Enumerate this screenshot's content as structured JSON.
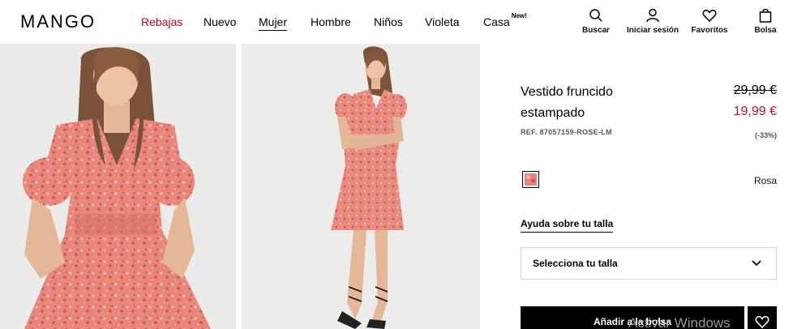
{
  "brand": {
    "logo": "MANGO"
  },
  "nav": [
    {
      "label": "Rebajas"
    },
    {
      "label": "Nuevo"
    },
    {
      "label": "Mujer"
    },
    {
      "label": "Hombre"
    },
    {
      "label": "Niños"
    },
    {
      "label": "Violeta"
    },
    {
      "label": "Casa",
      "badge": "New!"
    }
  ],
  "tools": [
    {
      "label": "Buscar",
      "icon": "search-icon"
    },
    {
      "label": "Iniciar sesión",
      "icon": "user-icon"
    },
    {
      "label": "Favoritos",
      "icon": "heart-icon"
    },
    {
      "label": "Bolsa",
      "icon": "bag-icon"
    }
  ],
  "product": {
    "name": "Vestido fruncido estampado",
    "ref": "REF. 87057159-ROSE-LM",
    "price_old": "29,99 €",
    "price_new": "19,99 €",
    "discount": "(-33%)",
    "color_name": "Rosa",
    "size_help": "Ayuda sobre tu talla",
    "size_select": "Selecciona tu talla",
    "add_button": "Añadir a la bolsa"
  },
  "colors": {
    "sale": "#d0021b",
    "price_new": "#c8102e",
    "dress": "#e9847a"
  },
  "watermark": "Activar Windows"
}
